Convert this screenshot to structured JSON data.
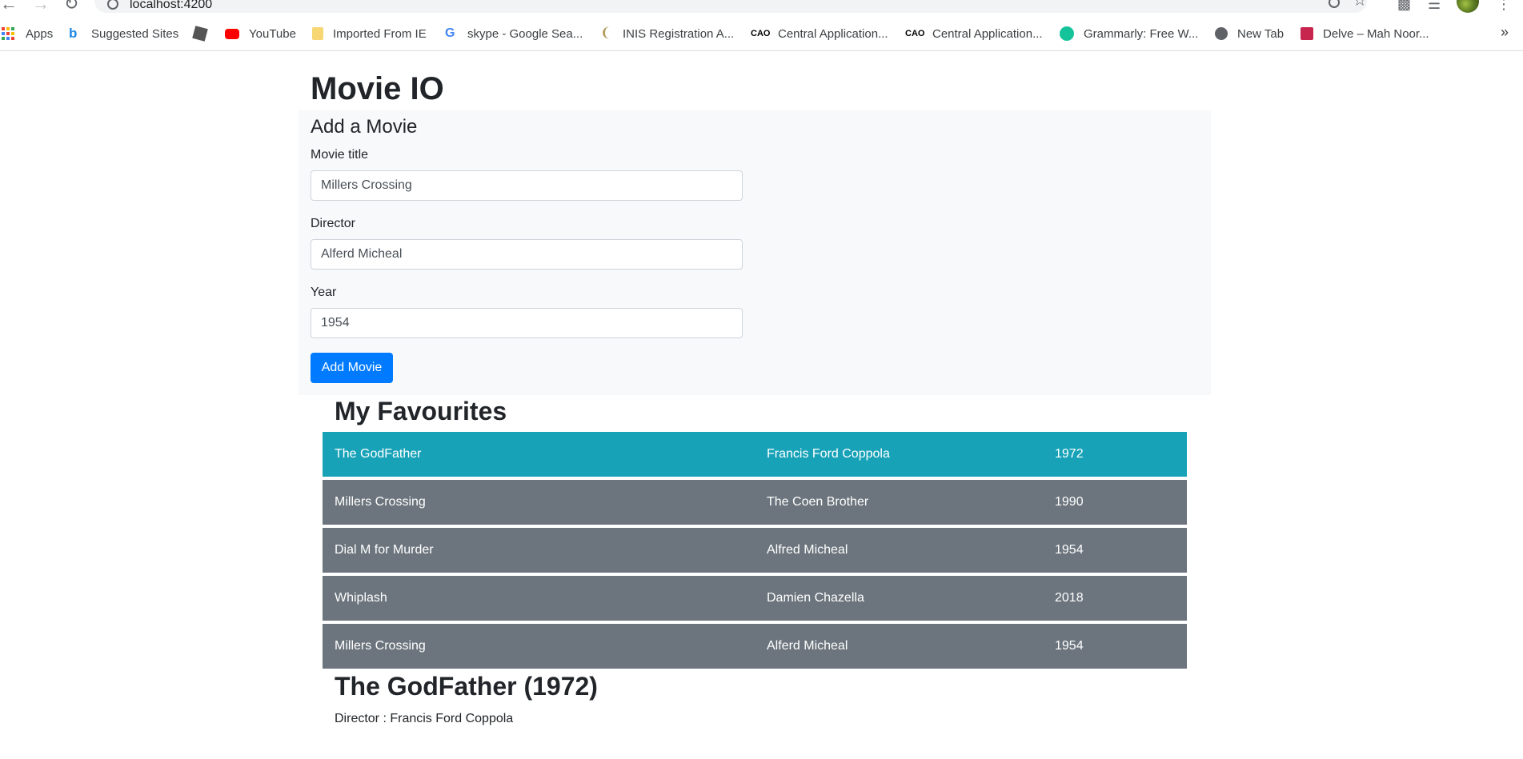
{
  "browser": {
    "url": "localhost:4200",
    "bookmarks": [
      {
        "label": "Apps",
        "icon": "apps-grid-icon"
      },
      {
        "label": "Suggested Sites",
        "icon": "bing-icon"
      },
      {
        "label": "",
        "icon": "roblox-icon"
      },
      {
        "label": "YouTube",
        "icon": "youtube-icon"
      },
      {
        "label": "Imported From IE",
        "icon": "folder-icon"
      },
      {
        "label": "skype - Google Sea...",
        "icon": "google-icon"
      },
      {
        "label": "INIS Registration A...",
        "icon": "harp-icon"
      },
      {
        "label": "Central Application...",
        "icon": "cao-icon"
      },
      {
        "label": "Central Application...",
        "icon": "cao-icon"
      },
      {
        "label": "Grammarly: Free W...",
        "icon": "grammarly-icon"
      },
      {
        "label": "New Tab",
        "icon": "globe-icon"
      },
      {
        "label": "Delve – Mah Noor...",
        "icon": "delve-icon"
      }
    ],
    "more": "»",
    "colors": {
      "youtube": "#ff0000",
      "grammarly": "#15c39a",
      "delve": "#c7254e",
      "folder": "#f7d774"
    }
  },
  "app": {
    "title": "Movie IO"
  },
  "form": {
    "heading": "Add a Movie",
    "fields": [
      {
        "label": "Movie title",
        "value": "Millers Crossing"
      },
      {
        "label": "Director",
        "value": "Alferd Micheal"
      },
      {
        "label": "Year",
        "value": "1954"
      }
    ],
    "submit_label": "Add Movie",
    "submit_color": "#007bff"
  },
  "favourites": {
    "heading": "My Favourites",
    "active_color": "#17a2b8",
    "row_color": "#6c757d",
    "rows": [
      {
        "title": "The GodFather",
        "director": "Francis Ford Coppola",
        "year": "1972",
        "active": true
      },
      {
        "title": "Millers Crossing",
        "director": "The Coen Brother",
        "year": "1990",
        "active": false
      },
      {
        "title": "Dial M for Murder",
        "director": "Alfred Micheal",
        "year": "1954",
        "active": false
      },
      {
        "title": "Whiplash",
        "director": "Damien Chazella",
        "year": "2018",
        "active": false
      },
      {
        "title": "Millers Crossing",
        "director": "Alferd Micheal",
        "year": "1954",
        "active": false
      }
    ]
  },
  "detail": {
    "title": "The GodFather (1972)",
    "director": "Director : Francis Ford Coppola"
  }
}
